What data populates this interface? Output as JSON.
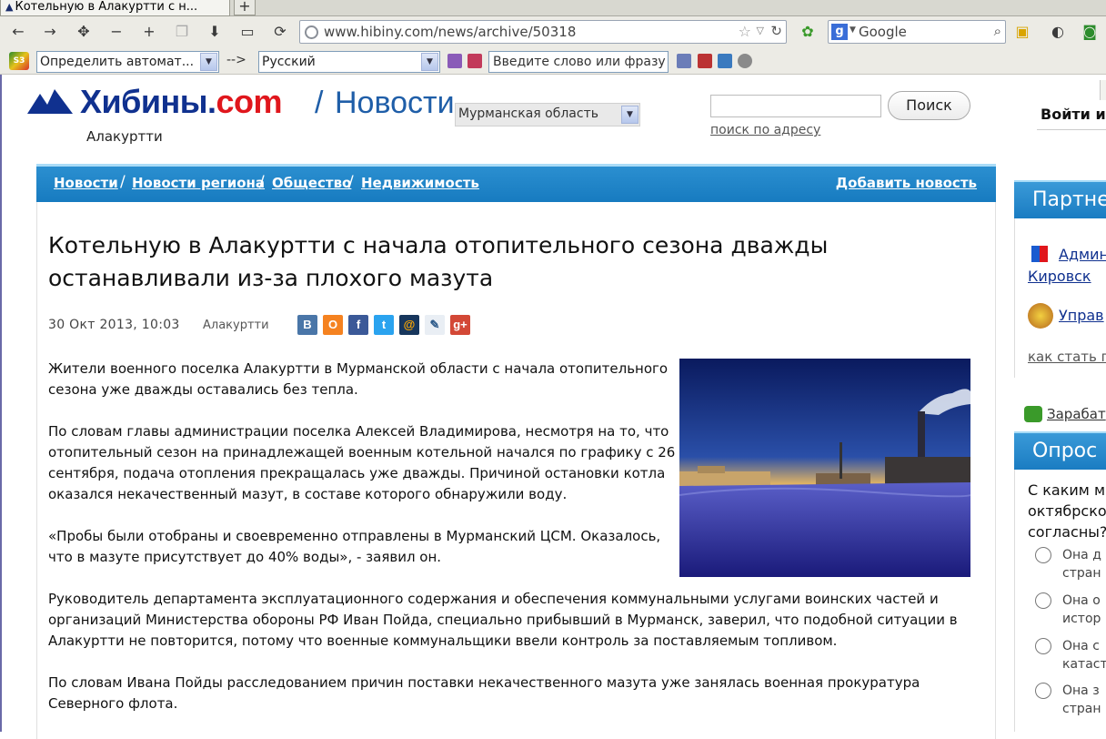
{
  "browser": {
    "tab_title": "Котельную в Алакуртти с н...",
    "new_tab_glyph": "+",
    "url": "www.hibiny.com/news/archive/50318",
    "search_engine": "Google",
    "translate": {
      "source_lang": "Определить автомат...",
      "arrow": "-->",
      "target_lang": "Русский",
      "input_placeholder": "Введите слово или фразу"
    }
  },
  "site": {
    "logo_main": "Хибины.",
    "logo_com": "com",
    "slash": "/",
    "section": "Новости",
    "city": "Алакуртти",
    "region": "Мурманская область",
    "search_button": "Поиск",
    "address_search": "поиск по адресу",
    "login": "Войти и..."
  },
  "breadcrumb": {
    "items": [
      "Новости",
      "Новости региона",
      "Общество",
      "Недвижимость"
    ],
    "separator": "/",
    "add_news": "Добавить новость"
  },
  "article": {
    "title": "Котельную в Алакуртти с начала отопительного сезона дважды останавливали из-за плохого мазута",
    "date": "30 Окт 2013, 10:03",
    "place": "Алакуртти",
    "share_icons": [
      "vkontakte",
      "odnoklassniki",
      "facebook",
      "twitter",
      "mail-ru",
      "livejournal",
      "google-plus"
    ],
    "paragraphs": [
      "Жители военного поселка Алакуртти в Мурманской области с начала отопительного сезона уже дважды оставались без тепла.",
      "По словам главы администрации поселка Алексей Владимирова, несмотря на то, что отопительный сезон на принадлежащей военным котельной начался по графику с 26 сентября, подача отопления прекращалась уже дважды. Причиной остановки котла оказался некачественный мазут, в составе которого обнаружили воду.",
      "«Пробы были отобраны и своевременно отправлены в Мурманский ЦСМ. Оказалось, что в мазуте присутствует до 40% воды», - заявил он.",
      "Руководитель департамента эксплуатационного содержания и обеспечения коммунальными услугами воинских частей и организаций Министерства обороны РФ Иван Пойда, специально прибывший в Мурманск, заверил, что подобной ситуации в Алакуртти не повторится, потому что военные коммунальщики ввели контроль за поставляемым топливом.",
      "По словам Ивана Пойды расследованием причин поставки некачественного мазута уже занялась военная прокуратура Северного флота."
    ]
  },
  "sidebar": {
    "partners_title": "Партнеры",
    "partner_1_line1": "Админ",
    "partner_1_line2": "Кировск",
    "partner_2": "Управ",
    "how_partner": "как стать п",
    "earn": "Зарабат",
    "poll_title": "Опрос",
    "poll_question": "С каким м октябрско согласны?",
    "poll_options": [
      {
        "line1": "Она д",
        "line2": "стран"
      },
      {
        "line1": "Она о",
        "line2": "истор"
      },
      {
        "line1": "Она с",
        "line2": "катаст"
      },
      {
        "line1": "Она з",
        "line2": "стран"
      }
    ]
  },
  "colors": {
    "brand_blue": "#10318f",
    "brand_red": "#e0161c",
    "bar_blue": "#1f86c8"
  }
}
